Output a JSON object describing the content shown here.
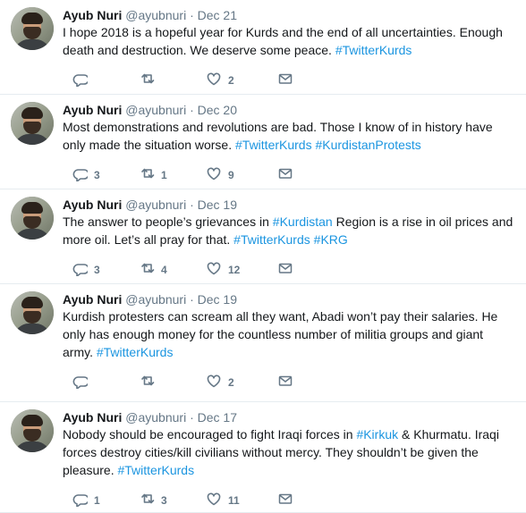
{
  "user": {
    "name": "Ayub Nuri",
    "handle": "@ayubnuri",
    "separator": "·"
  },
  "tweets": [
    {
      "date": "Dec 21",
      "lines": [
        [
          {
            "text": "I hope 2018 is a hopeful year for Kurds and the end of all uncertainties. Enough"
          }
        ],
        [
          {
            "text": "death and destruction. We deserve some peace. "
          },
          {
            "text": "#TwitterKurds",
            "tag": true
          }
        ]
      ],
      "replies": "",
      "retweets": "",
      "likes": "2"
    },
    {
      "date": "Dec 20",
      "lines": [
        [
          {
            "text": "Most demonstrations and revolutions are bad. Those I know of in history have"
          }
        ],
        [
          {
            "text": "only made the situation worse. "
          },
          {
            "text": "#TwitterKurds",
            "tag": true
          },
          {
            "text": " "
          },
          {
            "text": "#KurdistanProtests",
            "tag": true
          }
        ]
      ],
      "replies": "3",
      "retweets": "1",
      "likes": "9"
    },
    {
      "date": "Dec 19",
      "lines": [
        [
          {
            "text": "The answer to people’s grievances in "
          },
          {
            "text": "#Kurdistan",
            "tag": true
          },
          {
            "text": " Region is a rise in oil prices and"
          }
        ],
        [
          {
            "text": "more oil.  Let’s all pray for that. "
          },
          {
            "text": "#TwitterKurds",
            "tag": true
          },
          {
            "text": " "
          },
          {
            "text": "#KRG",
            "tag": true
          }
        ]
      ],
      "replies": "3",
      "retweets": "4",
      "likes": "12"
    },
    {
      "date": "Dec 19",
      "lines": [
        [
          {
            "text": "Kurdish protesters can scream all they want, Abadi won’t pay their salaries. He"
          }
        ],
        [
          {
            "text": "only has enough money for the countless number of militia groups and giant"
          }
        ],
        [
          {
            "text": "army. "
          },
          {
            "text": "#TwitterKurds",
            "tag": true
          }
        ]
      ],
      "replies": "",
      "retweets": "",
      "likes": "2"
    },
    {
      "date": "Dec 17",
      "lines": [
        [
          {
            "text": "Nobody should be encouraged to fight Iraqi forces in "
          },
          {
            "text": "#Kirkuk",
            "tag": true
          },
          {
            "text": " & Khurmatu. Iraqi"
          }
        ],
        [
          {
            "text": "forces destroy cities/kill civilians without mercy. They shouldn’t be given the"
          }
        ],
        [
          {
            "text": "pleasure. "
          },
          {
            "text": "#TwitterKurds",
            "tag": true
          }
        ]
      ],
      "replies": "1",
      "retweets": "3",
      "likes": "11"
    }
  ],
  "icons": {
    "reply": "reply-icon",
    "retweet": "retweet-icon",
    "like": "heart-icon",
    "message": "envelope-icon"
  },
  "colors": {
    "text": "#14171a",
    "muted": "#657786",
    "hashtag": "#1b95e0",
    "divider": "#e6ecf0"
  }
}
